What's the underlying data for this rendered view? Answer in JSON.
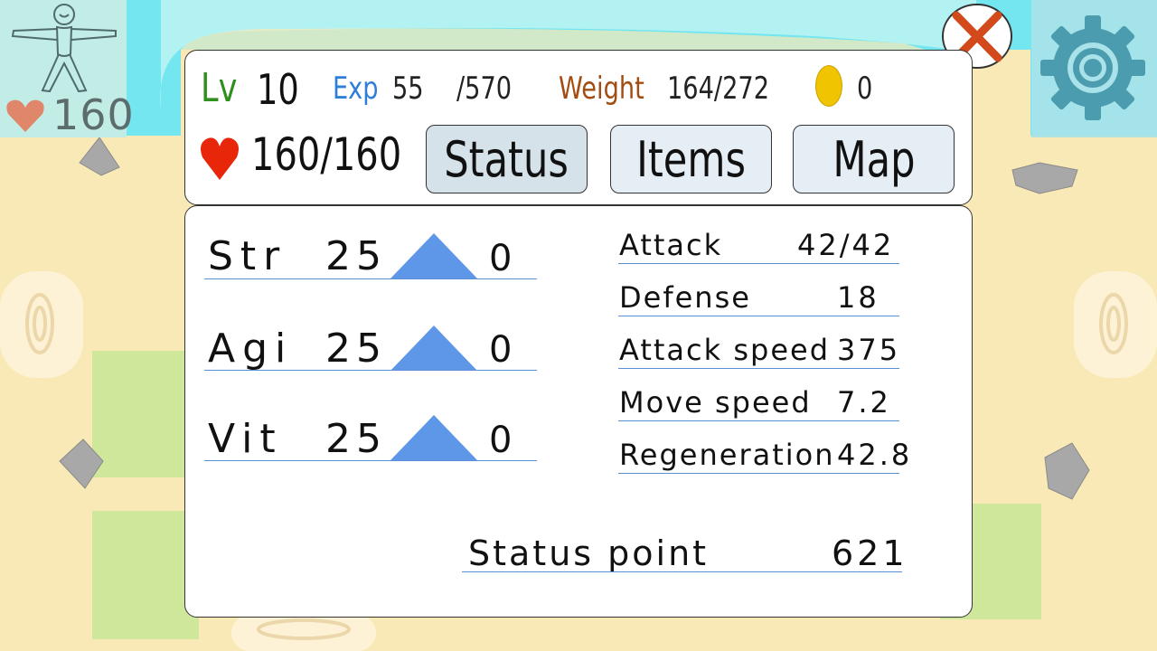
{
  "hud": {
    "hp": "160",
    "colors": {
      "sea": "#74e6f0",
      "sand": "#f9e9b6",
      "grass": "#cfe79b"
    }
  },
  "header": {
    "level_label": "Lv",
    "level": "10",
    "exp_label": "Exp",
    "exp_current": "55",
    "exp_max": "/570",
    "weight_label": "Weight",
    "weight": "164/272",
    "gold": "0",
    "hp": "160/160"
  },
  "tabs": [
    {
      "label": "Status",
      "active": true
    },
    {
      "label": "Items",
      "active": false
    },
    {
      "label": "Map",
      "active": false
    }
  ],
  "stats": [
    {
      "label": "Str",
      "value": "25",
      "points": "0"
    },
    {
      "label": "Agi",
      "value": "25",
      "points": "0"
    },
    {
      "label": "Vit",
      "value": "25",
      "points": "0"
    }
  ],
  "attributes": [
    {
      "label": "Attack",
      "value": "42/42"
    },
    {
      "label": "Defense",
      "value": "18"
    },
    {
      "label": "Attack speed",
      "value": "375"
    },
    {
      "label": "Move speed",
      "value": "7.2"
    },
    {
      "label": "Regeneration",
      "value": "42.8"
    }
  ],
  "status_point": {
    "label": "Status point",
    "value": "621"
  },
  "icons": {
    "close": "close-icon",
    "settings": "gear-icon",
    "heart": "heart-icon",
    "coin": "coin-icon",
    "avatar": "stick-figure-icon"
  }
}
